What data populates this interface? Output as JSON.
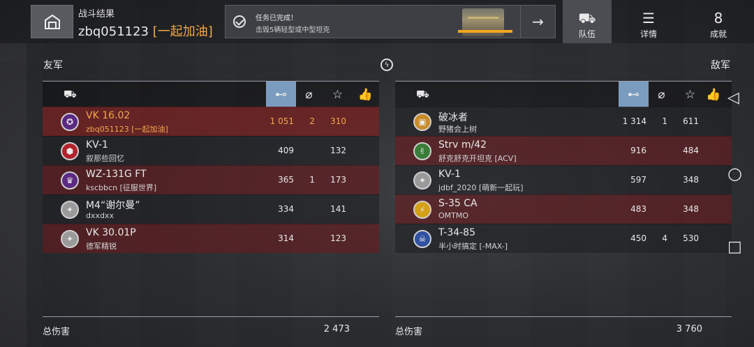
{
  "header": {
    "title": "战斗结果",
    "player": "zbq051123",
    "clan": "[一起加油]",
    "home_icon": "garage-icon"
  },
  "mission": {
    "status": "任务已完成！",
    "desc": "击毁5辆轻型或中型坦克",
    "progress": 1.0,
    "arrow": "→"
  },
  "tabs": [
    {
      "label": "队伍",
      "icon": "team-icon"
    },
    {
      "label": "详情",
      "icon": "list-icon"
    },
    {
      "label": "成就",
      "icon": "medal-icon"
    }
  ],
  "allies": {
    "label": "友军",
    "rows": [
      {
        "tank": "VK 16.02",
        "player": "zbq051123 [一起加油]",
        "damage": "1 051",
        "kills": "2",
        "xp": "310",
        "style": "me",
        "badge_color": "#5b2a82",
        "badge_glyph": "✪"
      },
      {
        "tank": "KV-1",
        "player": "叙那些回忆",
        "damage": "409",
        "kills": "",
        "xp": "132",
        "style": "dark",
        "badge_color": "#b2222c",
        "badge_glyph": "⬢"
      },
      {
        "tank": "WZ-131G FT",
        "player": "kscbbcn [征服世界]",
        "damage": "365",
        "kills": "1",
        "xp": "173",
        "style": "red",
        "badge_color": "#5b2a82",
        "badge_glyph": "♛"
      },
      {
        "tank": "M4“谢尔曼”",
        "player": "dxxdxx",
        "damage": "334",
        "kills": "",
        "xp": "141",
        "style": "dark",
        "badge_color": "#9a9a9a",
        "badge_glyph": "✦"
      },
      {
        "tank": "VK 30.01P",
        "player": "德军精锐",
        "damage": "314",
        "kills": "",
        "xp": "123",
        "style": "red",
        "badge_color": "#9a9a9a",
        "badge_glyph": "✦"
      }
    ],
    "total_label": "总伤害",
    "total": "2 473"
  },
  "enemies": {
    "label": "敌军",
    "rows": [
      {
        "tank": "破冰者",
        "player": "野猪会上树",
        "damage": "1 314",
        "kills": "1",
        "xp": "611",
        "style": "dark",
        "badge_color": "#c98b2a",
        "badge_glyph": "▣"
      },
      {
        "tank": "Strv m/42",
        "player": "舒克舒克开坦克 [ACV]",
        "damage": "916",
        "kills": "",
        "xp": "484",
        "style": "red",
        "badge_color": "#3a7d3a",
        "badge_glyph": "✌"
      },
      {
        "tank": "KV-1",
        "player": "jdbf_2020 [萌新一起玩]",
        "damage": "597",
        "kills": "",
        "xp": "348",
        "style": "dark",
        "badge_color": "#9a9a9a",
        "badge_glyph": "✦"
      },
      {
        "tank": "S-35 CA",
        "player": "OMTMO",
        "damage": "483",
        "kills": "",
        "xp": "348",
        "style": "red",
        "badge_color": "#d4a017",
        "badge_glyph": "⚡"
      },
      {
        "tank": "T-34-85",
        "player": "半小时搞定 [-MAX-]",
        "damage": "450",
        "kills": "4",
        "xp": "530",
        "style": "dark",
        "badge_color": "#3050a0",
        "badge_glyph": "☠"
      }
    ],
    "total_label": "总伤害",
    "total": "3 760"
  },
  "columns": {
    "tank_icon": "tank-icon",
    "damage_icon": "damage-icon",
    "kills_icon": "kills-icon",
    "xp_icon": "star-icon",
    "like_icon": "thumbs-up-icon"
  },
  "nav": {
    "back": "◁",
    "home": "○",
    "recent": "□"
  }
}
